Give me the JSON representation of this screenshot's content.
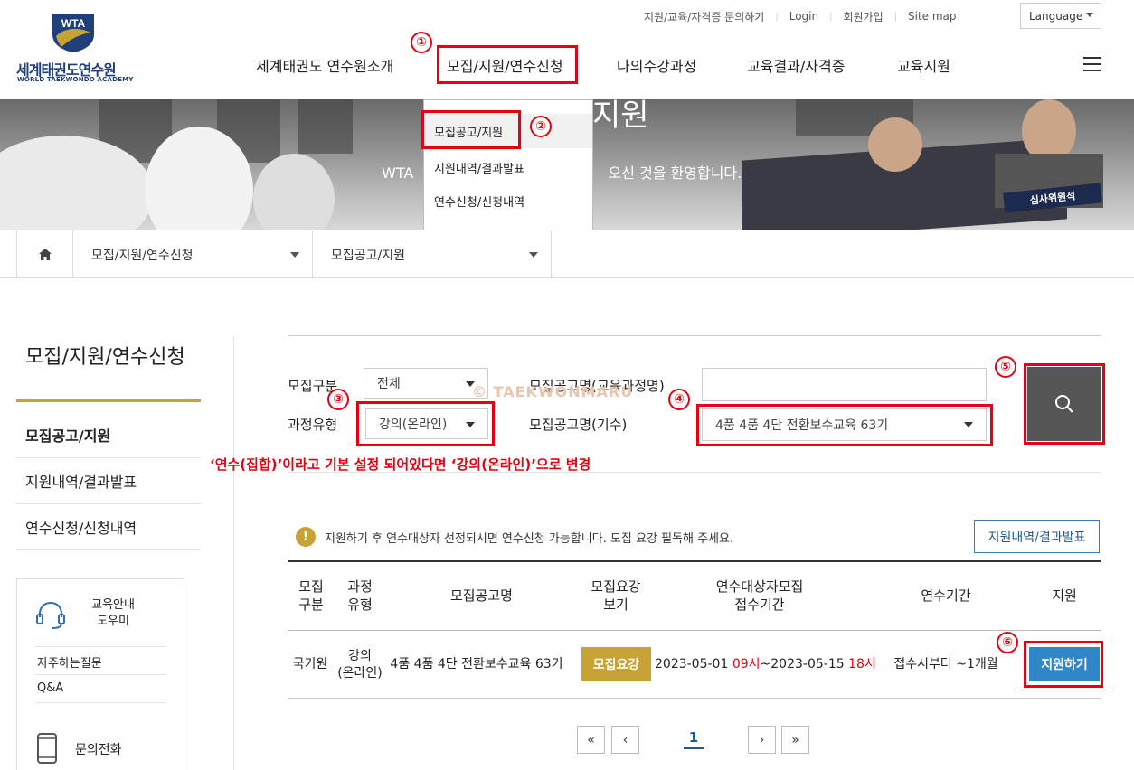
{
  "logo": {
    "badge": "WTA",
    "name_ko": "세계태권도연수원",
    "name_en": "WORLD TAEKWONDO ACADEMY"
  },
  "util": {
    "links": [
      "지원/교육/자격증 문의하기",
      "Login",
      "회원가입",
      "Site map"
    ],
    "language": "Language"
  },
  "gnb": {
    "items": [
      "세계태권도 연수원소개",
      "모집/지원/연수신청",
      "나의수강과정",
      "교육결과/자격증",
      "교육지원"
    ]
  },
  "dropdown": {
    "items": [
      "모집공고/지원",
      "지원내역/결과발표",
      "연수신청/신청내역"
    ]
  },
  "banner": {
    "title": "지원",
    "subtitle_left": "WTA",
    "subtitle_right": "오신 것을 환영합니다.",
    "sign": "심사위원석"
  },
  "breadcrumb": {
    "level1": "모집/지원/연수신청",
    "level2": "모집공고/지원"
  },
  "lnb": {
    "title": "모집/지원/연수신청",
    "items": [
      "모집공고/지원",
      "지원내역/결과발표",
      "연수신청/신청내역"
    ],
    "help_title": "교육안내 도우미",
    "help_links": [
      "자주하는질문",
      "Q&A"
    ],
    "phone_label": "문의전화"
  },
  "search": {
    "label_category": "모집구분",
    "category_value": "전체",
    "label_course_type": "과정유형",
    "course_type_value": "강의(온라인)",
    "label_name_text": "모집공고명(교육과정명)",
    "name_text_value": "",
    "label_name_session": "모집공고명(기수)",
    "name_session_value": "4품 4품 4단 전환보수교육 63기",
    "watermark": "© TAEKWONMARU",
    "note": "‘연수(집합)’이라고 기본 설정 되어있다면 ‘강의(온라인)’으로 변경"
  },
  "annotations": [
    "①",
    "②",
    "③",
    "④",
    "⑤",
    "⑥"
  ],
  "notice": {
    "icon": "!",
    "text": "지원하기 후 연수대상자 선정되시면 연수신청 가능합니다. 모집 요강 필독해 주세요.",
    "button": "지원내역/결과발표"
  },
  "table": {
    "headers": [
      "모집\n구분",
      "과정\n유형",
      "모집공고명",
      "모집요강\n보기",
      "연수대상자모집\n접수기간",
      "연수기간",
      "지원"
    ],
    "rows": [
      {
        "category": "국기원",
        "course_type": "강의\n(온라인)",
        "name": "4품 4품 4단 전환보수교육 63기",
        "guide_button": "모집요강",
        "period_start_date": "2023-05-01",
        "period_start_time": "09시",
        "period_sep": "~",
        "period_end_date": "2023-05-15",
        "period_end_time": "18시",
        "training_period": "접수시부터 ~1개월",
        "apply_button": "지원하기"
      }
    ]
  },
  "pagination": {
    "current": "1",
    "first": "«",
    "prev": "‹",
    "next": "›",
    "last": "»"
  },
  "colors": {
    "accent_red": "#e60012",
    "gold": "#c6a334",
    "blue": "#2f87c8",
    "navy": "#1f3f7a"
  },
  "icons": [
    "home-icon",
    "search-icon",
    "headset-icon",
    "mobile-phone-icon",
    "hamburger-menu-icon",
    "exclamation-icon",
    "chevron-down-icon"
  ]
}
